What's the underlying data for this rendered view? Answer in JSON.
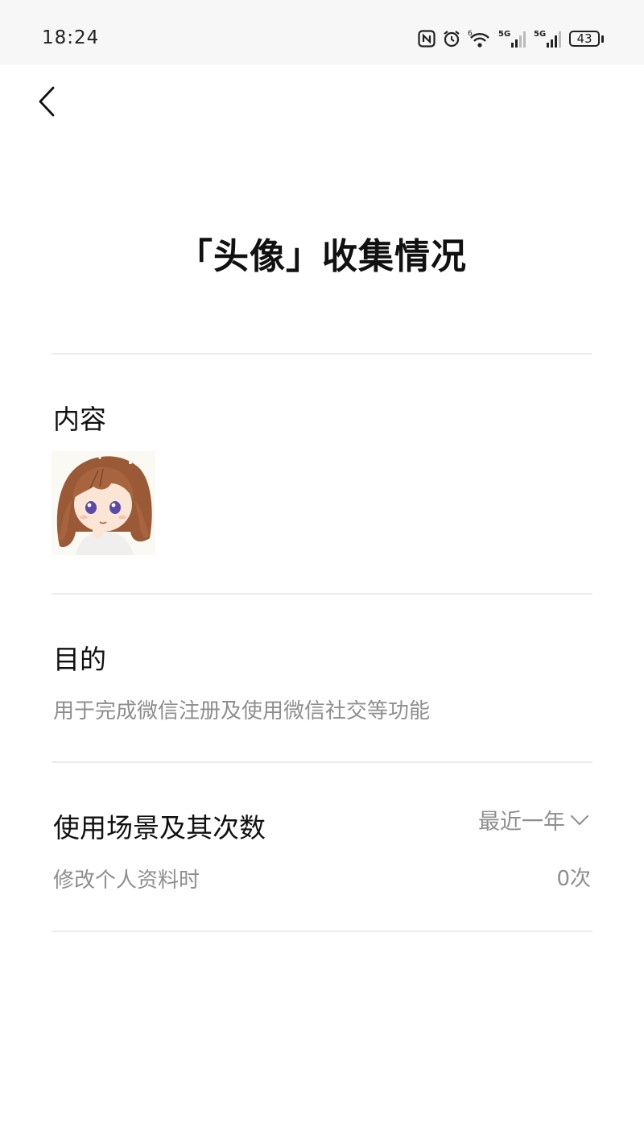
{
  "status_bar": {
    "time": "18:24",
    "battery": "43",
    "icons": [
      "nfc-icon",
      "alarm-icon",
      "wifi-icon",
      "signal-5g-icon",
      "signal-5g-icon",
      "battery-icon"
    ]
  },
  "nav": {
    "back_icon": "chevron-left-icon"
  },
  "page": {
    "title": "「头像」收集情况"
  },
  "content_section": {
    "heading": "内容",
    "avatar_icon": "avatar-image"
  },
  "purpose_section": {
    "heading": "目的",
    "text": "用于完成微信注册及使用微信社交等功能"
  },
  "usage_section": {
    "heading": "使用场景及其次数",
    "period_label": "最近一年",
    "period_icon": "chevron-down-icon",
    "scene_label": "修改个人资料时",
    "count": "0次"
  },
  "colors": {
    "text_primary": "#111111",
    "text_secondary": "#8e8e8e",
    "divider": "#ececec",
    "background": "#ffffff"
  }
}
